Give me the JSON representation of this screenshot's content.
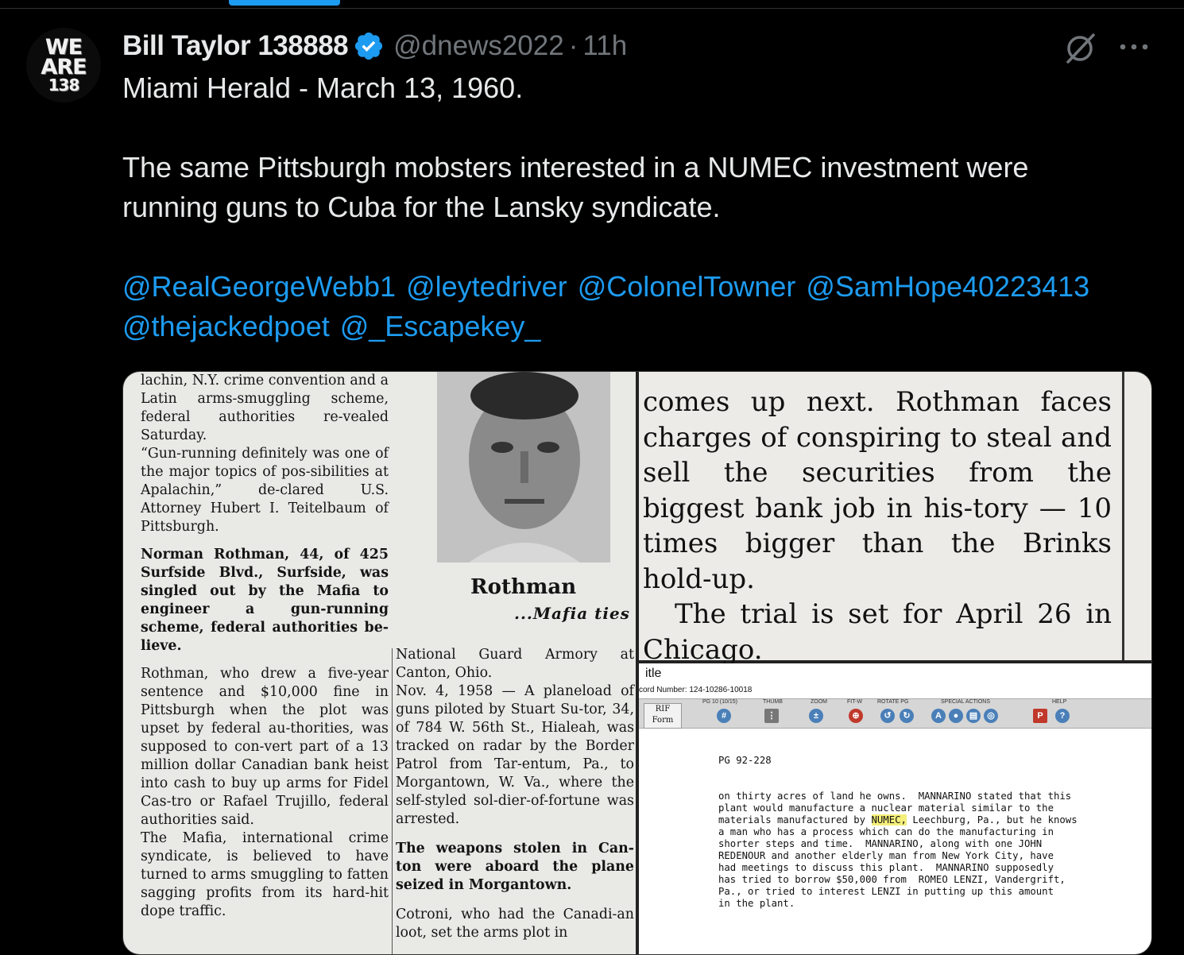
{
  "tweet": {
    "author_name": "Bill Taylor 138888",
    "handle": "@dnews2022",
    "separator": "·",
    "time": "11h",
    "avatar_text": [
      "WE",
      "ARE",
      "138"
    ],
    "text_line1": "Miami Herald - March 13, 1960.",
    "text_para2_line1": "The same Pittsburgh mobsters interested in a NUMEC investment were",
    "text_para2_line2": "running guns to Cuba for the Lansky syndicate.",
    "mentions": [
      "@RealGeorgeWebb1",
      "@leytedriver",
      "@ColonelTowner",
      "@SamHope40223413",
      "@thejackedpoet",
      "@_Escapekey_"
    ]
  },
  "icons": {
    "verified": "verified-badge-icon",
    "grok": "grok-icon",
    "more": "more-options-icon"
  },
  "colors": {
    "background": "#000000",
    "text": "#e7e9ea",
    "muted": "#71767b",
    "accent": "#1d9bf0"
  },
  "clip_left": {
    "col1": [
      "lachin, N.Y. crime convention and a Latin arms-smuggling scheme, federal authorities re-vealed Saturday.",
      "“Gun-running definitely was one of the major topics of pos-sibilities at Apalachin,” de-clared U.S. Attorney Hubert I. Teitelbaum of Pittsburgh.",
      "Norman Rothman, 44, of 425 Surfside Blvd., Surfside, was singled out by the Mafia to engineer a gun-running scheme, federal authorities be-lieve.",
      "Rothman, who drew a five-year sentence and $10,000 fine in Pittsburgh when the plot was upset by federal au-thorities, was supposed to con-vert part of a 13 million dollar Canadian bank heist into cash to buy up arms for Fidel Cas-tro or Rafael Trujillo, federal authorities said.",
      "The Mafia, international crime syndicate, is believed to have turned to arms smuggling to fatten sagging profits from its hard-hit dope traffic."
    ],
    "photo_name": "Rothman",
    "photo_caption": "...Mafia ties",
    "col2": [
      "National Guard Armory at Canton, Ohio.",
      "Nov. 4, 1958 — A planeload of guns piloted by Stuart Su-tor, 34, of 784 W. 56th St., Hialeah, was tracked on radar by the Border Patrol from Tar-entum, Pa., to Morgantown, W. Va., where the self-styled sol-dier-of-fortune was arrested.",
      "The weapons stolen in Can-ton were aboard the plane seized in Morgantown.",
      "Cotroni, who had the Canadi-an loot, set the arms plot in"
    ]
  },
  "clip_right_top": {
    "text": [
      "comes up next. Rothman faces charges of conspiring to steal and sell the securities from the biggest bank job in his-tory — 10 times bigger than the Brinks hold-up.",
      "The trial is set for April 26 in Chicago."
    ]
  },
  "clip_right_bottom": {
    "header_title": "itle",
    "record_number": "cord Number: 124-10286-10018",
    "toolbar_labels": [
      "PG 10 (10/15)",
      "THUMB",
      "ZOOM",
      "FIT-W",
      "ROTATE PG",
      "SPECIAL ACTIONS",
      "HELP"
    ],
    "rif_label_1": "RIF",
    "rif_label_2": "Form",
    "page_ref": "PG 92-228",
    "lines": [
      "on thirty acres of land he owns.  MANNARINO stated that this",
      "plant would manufacture a nuclear material similar to the",
      "materials manufactured by ",
      "a man who has a process which can do the manufacturing in",
      "shorter steps and time.  MANNARINO, along with one JOHN",
      "REDENOUR and another elderly man from New York City, have",
      "had meetings to discuss this plant.  MANNARINO supposedly",
      "has tried to borrow $50,000 from  ROMEO LENZI, Vandergrift,",
      "Pa., or tried to interest LENZI in putting up this amount",
      "in the plant."
    ],
    "highlight_word": "NUMEC,",
    "line3_tail": " Leechburg, Pa., but he knows"
  }
}
